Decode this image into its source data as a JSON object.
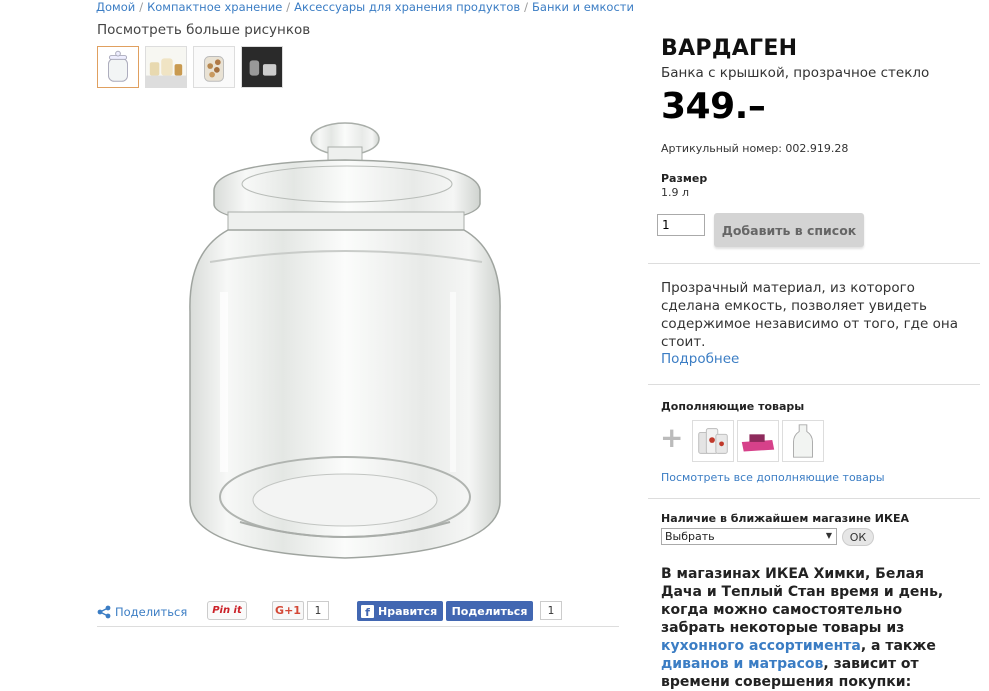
{
  "breadcrumb": [
    "Домой",
    "Компактное хранение",
    "Аксессуары для хранения продуктов",
    "Банки и емкости"
  ],
  "gallery": {
    "more_label": "Посмотреть больше рисунков"
  },
  "social": {
    "share_label": "Поделиться",
    "pinit_label": "Pin it",
    "gplus_label": "G+1",
    "gplus_count": "1",
    "fb_like_label": "Нравится",
    "fb_share_label": "Поделиться",
    "fb_count": "1"
  },
  "product": {
    "name": "ВАРДАГЕН",
    "subtitle": "Банка с крышкой, прозрачное стекло",
    "price": "349.–",
    "article_label": "Артикульный номер: 002.919.28",
    "size_label": "Размер",
    "size_value": "1.9 л",
    "quantity": "1",
    "add_button": "Добавить в список",
    "description": "Прозрачный материал, из которого сделана емкость, позволяет увидеть содержимое независимо от того, где она стоит.",
    "more_link": "Подробнее"
  },
  "complementary": {
    "title": "Дополняющие товары",
    "see_all": "Посмотреть все дополняющие товары"
  },
  "availability": {
    "title": "Наличие в ближайшем магазине ИКЕА",
    "select_value": "Выбрать",
    "ok_label": "ОК",
    "info_part1": "В магазинах ИКЕА Химки, Белая Дача и Теплый Стан время и день, когда можно самостоятельно забрать некоторые товары из ",
    "info_link1": "кухонного ассортимента",
    "info_part2": ", а также ",
    "info_link2": "диванов и матрасов",
    "info_part3": ", зависит от времени совершения покупки:"
  },
  "colors": {
    "link": "#3b7dc4",
    "facebook": "#4267b2",
    "thumb_active_border": "#e0a060"
  }
}
